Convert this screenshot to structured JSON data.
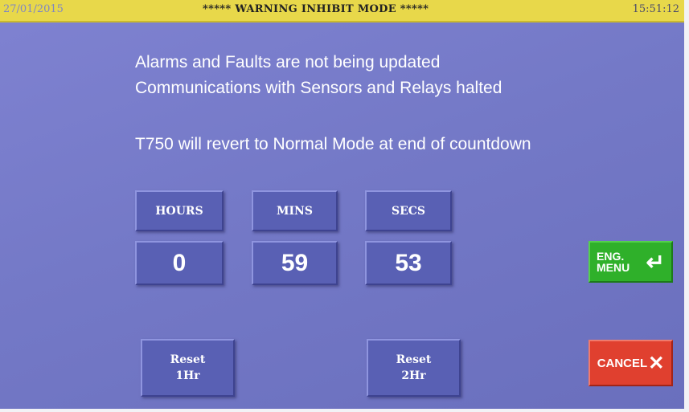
{
  "status_bar": {
    "date": "27/01/2015",
    "title": "***** WARNING INHIBIT MODE *****",
    "time": "15:51:12"
  },
  "messages": {
    "line1": "Alarms and Faults are not being updated",
    "line2": "Communications with Sensors and Relays halted",
    "line3": "T750 will revert to Normal Mode at end of countdown"
  },
  "countdown": {
    "hours_label": "HOURS",
    "mins_label": "MINS",
    "secs_label": "SECS",
    "hours": "0",
    "mins": "59",
    "secs": "53"
  },
  "buttons": {
    "reset_1hr_line1": "Reset",
    "reset_1hr_line2": "1Hr",
    "reset_2hr_line1": "Reset",
    "reset_2hr_line2": "2Hr",
    "eng_menu_line1": "ENG.",
    "eng_menu_line2": "MENU",
    "cancel": "CANCEL"
  },
  "icons": {
    "enter": "enter-arrow-icon",
    "cancel": "x-icon"
  },
  "colors": {
    "status_bar": "#e8d84a",
    "background": "#7479c7",
    "button": "#5960b4",
    "eng_menu": "#2fb02a",
    "cancel": "#e0402f"
  }
}
